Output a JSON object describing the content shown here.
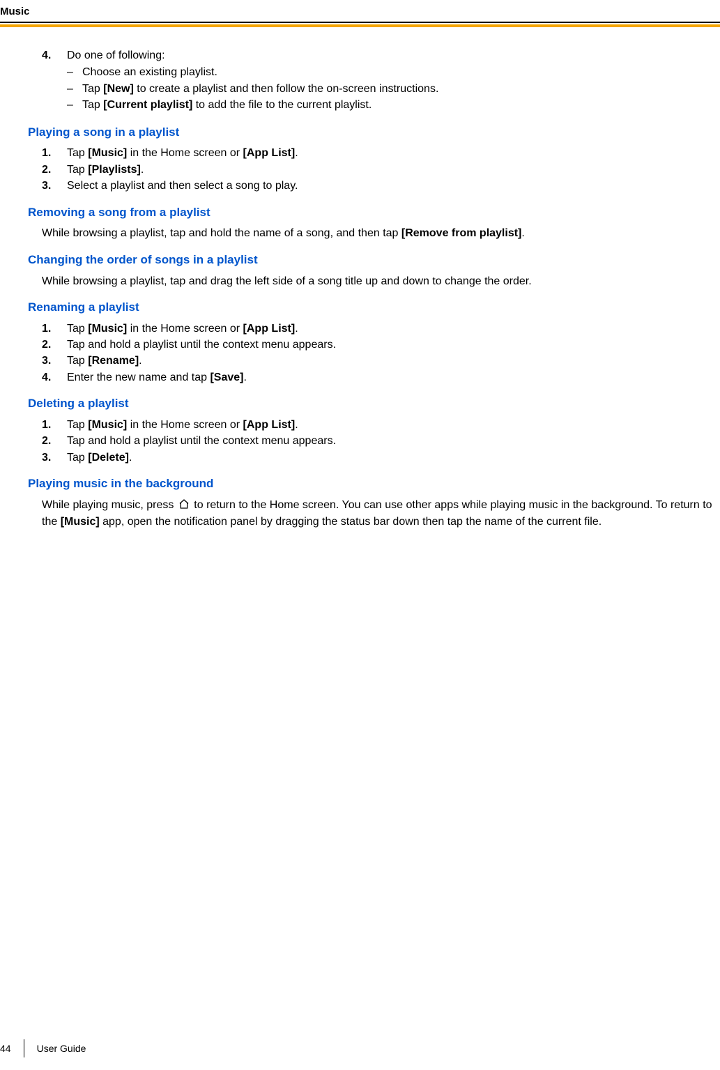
{
  "header": {
    "title": "Music"
  },
  "step4": {
    "marker": "4.",
    "text": "Do one of following:",
    "sub": [
      {
        "dash": "–",
        "pre": "Choose an existing playlist."
      },
      {
        "dash": "–",
        "pre": "Tap ",
        "bold": "[New]",
        "post": " to create a playlist and then follow the on-screen instructions."
      },
      {
        "dash": "–",
        "pre": "Tap ",
        "bold": "[Current playlist]",
        "post": " to add the file to the current playlist."
      }
    ]
  },
  "sec1": {
    "heading": "Playing a song in a playlist",
    "items": [
      {
        "m": "1.",
        "p1": "Tap ",
        "b1": "[Music]",
        "p2": " in the Home screen or ",
        "b2": "[App List]",
        "p3": "."
      },
      {
        "m": "2.",
        "p1": "Tap ",
        "b1": "[Playlists]",
        "p2": "."
      },
      {
        "m": "3.",
        "p1": "Select a playlist and then select a song to play."
      }
    ]
  },
  "sec2": {
    "heading": "Removing a song from a playlist",
    "para_pre": "While browsing a playlist, tap and hold the name of a song, and then tap ",
    "para_bold": "[Remove from playlist]",
    "para_post": "."
  },
  "sec3": {
    "heading": "Changing the order of songs in a playlist",
    "para": "While browsing a playlist, tap and drag the left side of a song title up and down to change the order."
  },
  "sec4": {
    "heading": "Renaming a playlist",
    "items": [
      {
        "m": "1.",
        "p1": "Tap ",
        "b1": "[Music]",
        "p2": " in the Home screen or ",
        "b2": "[App List]",
        "p3": "."
      },
      {
        "m": "2.",
        "p1": "Tap and hold a playlist until the context menu appears."
      },
      {
        "m": "3.",
        "p1": "Tap ",
        "b1": "[Rename]",
        "p2": "."
      },
      {
        "m": "4.",
        "p1": "Enter the new name and tap ",
        "b1": "[Save]",
        "p2": "."
      }
    ]
  },
  "sec5": {
    "heading": "Deleting a playlist",
    "items": [
      {
        "m": "1.",
        "p1": "Tap ",
        "b1": "[Music]",
        "p2": " in the Home screen or ",
        "b2": "[App List]",
        "p3": "."
      },
      {
        "m": "2.",
        "p1": "Tap and hold a playlist until the context menu appears."
      },
      {
        "m": "3.",
        "p1": "Tap ",
        "b1": "[Delete]",
        "p2": "."
      }
    ]
  },
  "sec6": {
    "heading": "Playing music in the background",
    "p1": "While playing music, press ",
    "p2": " to return to the Home screen. You can use other apps while playing music in the background. To return to the ",
    "b1": "[Music]",
    "p3": " app, open the notification panel by dragging the status bar down then tap the name of the current file."
  },
  "footer": {
    "page": "44",
    "guide": "User Guide"
  }
}
